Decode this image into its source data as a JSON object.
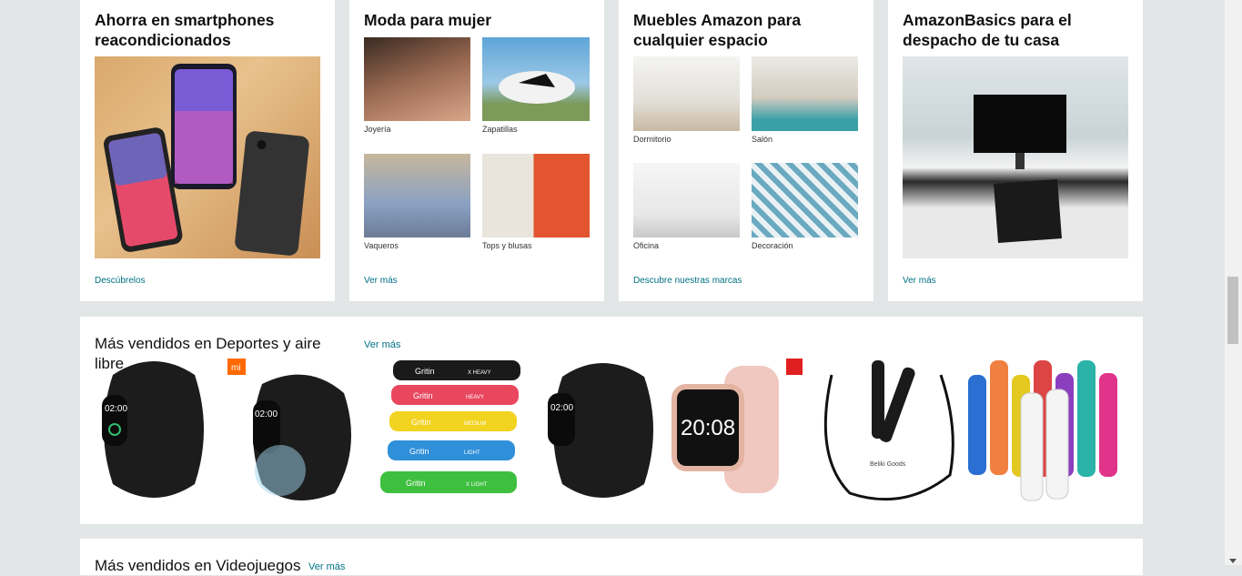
{
  "cards": [
    {
      "title": "Ahorra en smartphones reacondicionados",
      "link": "Descúbrelos"
    },
    {
      "title": "Moda para mujer",
      "link": "Ver más",
      "items": [
        "Joyería",
        "Zapatillas",
        "Vaqueros",
        "Tops y blusas"
      ]
    },
    {
      "title": "Muebles Amazon para cualquier espacio",
      "link": "Descubre nuestras marcas",
      "items": [
        "Dormitorio",
        "Salón",
        "Oficina",
        "Decoración"
      ]
    },
    {
      "title": "AmazonBasics para el despacho de tu casa",
      "link": "Ver más"
    }
  ],
  "sports": {
    "title": "Más vendidos en Deportes y aire libre",
    "link": "Ver más",
    "products": [
      {
        "name": "smart-band",
        "screen": "02:00"
      },
      {
        "name": "mi-band",
        "screen": "02:00",
        "brand": "mi"
      },
      {
        "name": "resistance-bands",
        "labels": [
          "Gritin",
          "Gritin",
          "Gritin",
          "Gritin",
          "Gritin"
        ],
        "levels": [
          "X HEAVY",
          "HEAVY",
          "MEDIUM",
          "LIGHT",
          "X LIGHT"
        ]
      },
      {
        "name": "smart-band-2",
        "screen": "02:00"
      },
      {
        "name": "smartwatch",
        "screen": "20:08"
      },
      {
        "name": "jump-rope",
        "brand": "Beliki Goods"
      },
      {
        "name": "water-bottles"
      }
    ]
  },
  "videogames": {
    "title": "Más vendidos en Videojuegos",
    "link": "Ver más"
  },
  "colors": {
    "link": "#007185",
    "bg": "#e3e6e6"
  }
}
